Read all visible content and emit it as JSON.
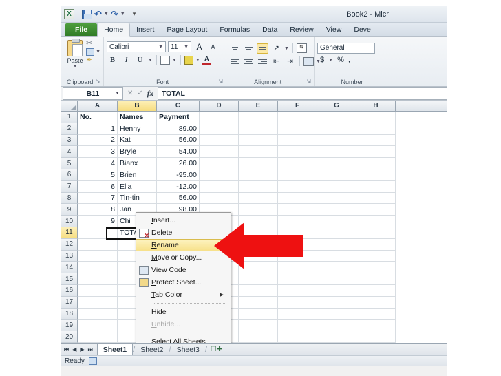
{
  "window": {
    "title": "Book2 - Micr"
  },
  "qat": {
    "logo": "excel-logo-icon",
    "items": [
      "save-icon",
      "undo-icon",
      "redo-icon",
      "customize-qat-icon"
    ]
  },
  "ribbon": {
    "tabs": [
      {
        "label": "File",
        "state": "file"
      },
      {
        "label": "Home",
        "state": "active"
      },
      {
        "label": "Insert",
        "state": ""
      },
      {
        "label": "Page Layout",
        "state": ""
      },
      {
        "label": "Formulas",
        "state": ""
      },
      {
        "label": "Data",
        "state": ""
      },
      {
        "label": "Review",
        "state": ""
      },
      {
        "label": "View",
        "state": ""
      },
      {
        "label": "Deve",
        "state": ""
      }
    ],
    "groups": {
      "clipboard": {
        "label": "Clipboard",
        "paste": "Paste",
        "dialog": "↘"
      },
      "font": {
        "label": "Font",
        "font_name": "Calibri",
        "font_size": "11",
        "bold": "B",
        "italic": "I",
        "underline": "U",
        "grow": "A",
        "shrink": "A",
        "font_color": "A",
        "dialog": "↘"
      },
      "alignment": {
        "label": "Alignment",
        "dialog": "↘"
      },
      "number": {
        "label": "Number",
        "format": "General",
        "currency": "$",
        "percent": "%",
        "comma": ","
      }
    }
  },
  "formula_bar": {
    "name_box": "B11",
    "fx": "fx",
    "content": "TOTAL"
  },
  "grid": {
    "columns": [
      "A",
      "B",
      "C",
      "D",
      "E",
      "F",
      "G",
      "H"
    ],
    "selected_column": "B",
    "selected_row": 11,
    "selected_cell": "B11",
    "rows": [
      {
        "n": "1",
        "cells": [
          "No.",
          "Names",
          "Payment",
          "",
          "",
          "",
          "",
          ""
        ]
      },
      {
        "n": "2",
        "cells": [
          "1",
          "Henny",
          "89.00",
          "",
          "",
          "",
          "",
          ""
        ]
      },
      {
        "n": "3",
        "cells": [
          "2",
          "Kat",
          "56.00",
          "",
          "",
          "",
          "",
          ""
        ]
      },
      {
        "n": "4",
        "cells": [
          "3",
          "Bryle",
          "54.00",
          "",
          "",
          "",
          "",
          ""
        ]
      },
      {
        "n": "5",
        "cells": [
          "4",
          "Bianx",
          "26.00",
          "",
          "",
          "",
          "",
          ""
        ]
      },
      {
        "n": "6",
        "cells": [
          "5",
          "Brien",
          "-95.00",
          "",
          "",
          "",
          "",
          ""
        ]
      },
      {
        "n": "7",
        "cells": [
          "6",
          "Ella",
          "-12.00",
          "",
          "",
          "",
          "",
          ""
        ]
      },
      {
        "n": "8",
        "cells": [
          "7",
          "Tin-tin",
          "56.00",
          "",
          "",
          "",
          "",
          ""
        ]
      },
      {
        "n": "9",
        "cells": [
          "8",
          "Jan",
          "98.00",
          "",
          "",
          "",
          "",
          ""
        ]
      },
      {
        "n": "10",
        "cells": [
          "9",
          "Chi",
          "",
          "",
          "",
          "",
          "",
          ""
        ]
      },
      {
        "n": "11",
        "cells": [
          "",
          "TOTAL",
          "",
          "",
          "",
          "",
          "",
          ""
        ]
      },
      {
        "n": "12",
        "cells": [
          "",
          "",
          "",
          "",
          "",
          "",
          "",
          ""
        ]
      },
      {
        "n": "13",
        "cells": [
          "",
          "",
          "",
          "",
          "",
          "",
          "",
          ""
        ]
      },
      {
        "n": "14",
        "cells": [
          "",
          "",
          "",
          "",
          "",
          "",
          "",
          ""
        ]
      },
      {
        "n": "15",
        "cells": [
          "",
          "",
          "",
          "",
          "",
          "",
          "",
          ""
        ]
      },
      {
        "n": "16",
        "cells": [
          "",
          "",
          "",
          "",
          "",
          "",
          "",
          ""
        ]
      },
      {
        "n": "17",
        "cells": [
          "",
          "",
          "",
          "",
          "",
          "",
          "",
          ""
        ]
      },
      {
        "n": "18",
        "cells": [
          "",
          "",
          "",
          "",
          "",
          "",
          "",
          ""
        ]
      },
      {
        "n": "19",
        "cells": [
          "",
          "",
          "",
          "",
          "",
          "",
          "",
          ""
        ]
      },
      {
        "n": "20",
        "cells": [
          "",
          "",
          "",
          "",
          "",
          "",
          "",
          ""
        ]
      }
    ]
  },
  "context_menu": {
    "highlighted": "Rename",
    "items": [
      {
        "label": "Insert...",
        "accel": "I",
        "icon": "",
        "state": ""
      },
      {
        "label": "Delete",
        "accel": "D",
        "icon": "delete-sheet-icon",
        "state": ""
      },
      {
        "label": "Rename",
        "accel": "R",
        "icon": "",
        "state": "highlighted"
      },
      {
        "label": "Move or Copy...",
        "accel": "M",
        "icon": "",
        "state": ""
      },
      {
        "label": "View Code",
        "accel": "V",
        "icon": "view-code-icon",
        "state": ""
      },
      {
        "label": "Protect Sheet...",
        "accel": "P",
        "icon": "protect-sheet-icon",
        "state": ""
      },
      {
        "label": "Tab Color",
        "accel": "T",
        "icon": "",
        "state": "submenu"
      },
      {
        "label": "separator",
        "accel": "",
        "icon": "",
        "state": "separator"
      },
      {
        "label": "Hide",
        "accel": "H",
        "icon": "",
        "state": ""
      },
      {
        "label": "Unhide...",
        "accel": "U",
        "icon": "",
        "state": "disabled"
      },
      {
        "label": "separator",
        "accel": "",
        "icon": "",
        "state": "separator"
      },
      {
        "label": "Select All Sheets",
        "accel": "S",
        "icon": "",
        "state": ""
      }
    ]
  },
  "annotation": {
    "arrow": "red-left-arrow",
    "color": "#ee1111"
  },
  "sheet_tabs": {
    "nav": [
      "⏮",
      "◀",
      "▶",
      "⏭"
    ],
    "tabs": [
      {
        "label": "Sheet1",
        "active": true
      },
      {
        "label": "Sheet2",
        "active": false
      },
      {
        "label": "Sheet3",
        "active": false
      }
    ],
    "insert_sheet": "insert-worksheet-icon"
  },
  "status_bar": {
    "text": "Ready",
    "icon": "status-icon"
  }
}
